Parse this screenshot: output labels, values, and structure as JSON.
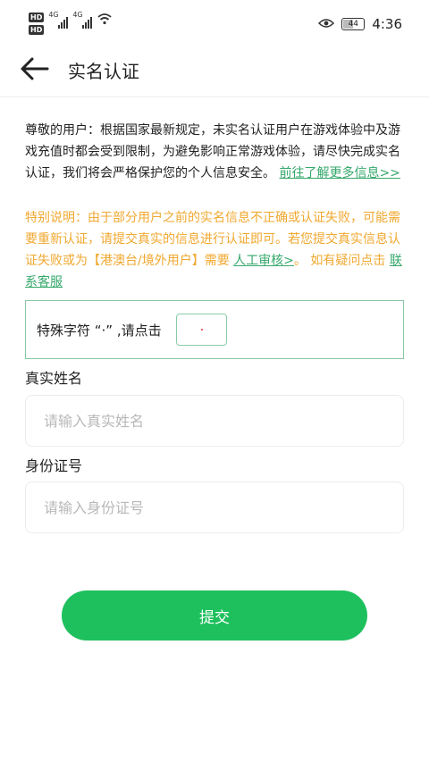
{
  "status_bar": {
    "hd1": "HD",
    "hd2": "HD",
    "net1": "4G",
    "net2": "4G",
    "battery": "44",
    "time": "4:36"
  },
  "header": {
    "title": "实名认证"
  },
  "notice": {
    "text": "尊敬的用户：根据国家最新规定，未实名认证用户在游戏体验中及游戏充值时都会受到限制，为避免影响正常游戏体验，请尽快完成实名认证，我们将会严格保护您的个人信息安全。",
    "link": "前往了解更多信息>>"
  },
  "special": {
    "text1": "特别说明：由于部分用户之前的实名信息不正确或认证失败，可能需要重新认证，请提交真实的信息进行认证即可。若您提交真实信息认证失败或为【港澳台/境外用户】需要",
    "link1": "人工审核>",
    "text2": "。 如有疑问点击",
    "link2": "联系客服"
  },
  "captcha": {
    "text": "特殊字符 “·” ,请点击"
  },
  "form": {
    "name_label": "真实姓名",
    "name_placeholder": "请输入真实姓名",
    "id_label": "身份证号",
    "id_placeholder": "请输入身份证号",
    "submit_label": "提交"
  },
  "colors": {
    "accent": "#1ec05d",
    "link": "#35a86b",
    "warning": "#f0a830"
  },
  "icons": {
    "back": "arrow-left-icon",
    "eye": "eye-icon",
    "wifi": "wifi-icon",
    "battery": "battery-icon"
  }
}
